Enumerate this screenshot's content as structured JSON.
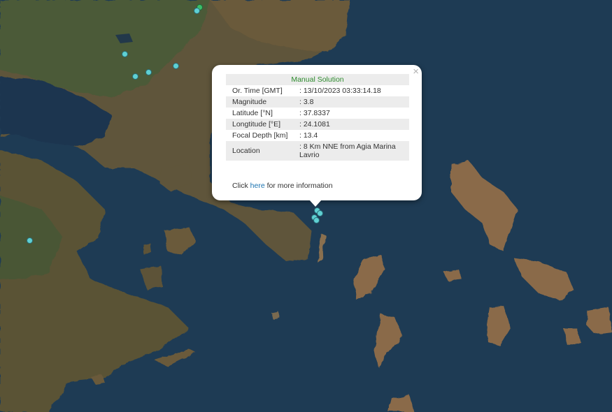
{
  "popup": {
    "header": "Manual Solution",
    "rows": [
      {
        "label": "Or. Time [GMT]",
        "value": ": 13/10/2023 03:33:14.18"
      },
      {
        "label": "Magnitude",
        "value": ": 3.8"
      },
      {
        "label": "Latitude [°N]",
        "value": ": 37.8337"
      },
      {
        "label": "Longtitude [°E]",
        "value": ": 24.1081"
      },
      {
        "label": "Focal Depth [km]",
        "value": ": 13.4"
      },
      {
        "label": "Location",
        "value": ": 8 Km NNE from Agia Marina Lavrio"
      }
    ],
    "footer_prefix": "Click ",
    "footer_link": "here",
    "footer_suffix": " for more information",
    "close_glyph": "×"
  },
  "colors": {
    "sea": "#1d3a52",
    "land": "#6b5a3a",
    "marker": "#5fd0d3",
    "marker_green": "#3bbf6a",
    "header_green": "#2e8b2e",
    "link": "#1a73b0"
  },
  "icons": {
    "close": "close-icon",
    "marker": "earthquake-marker-icon"
  }
}
